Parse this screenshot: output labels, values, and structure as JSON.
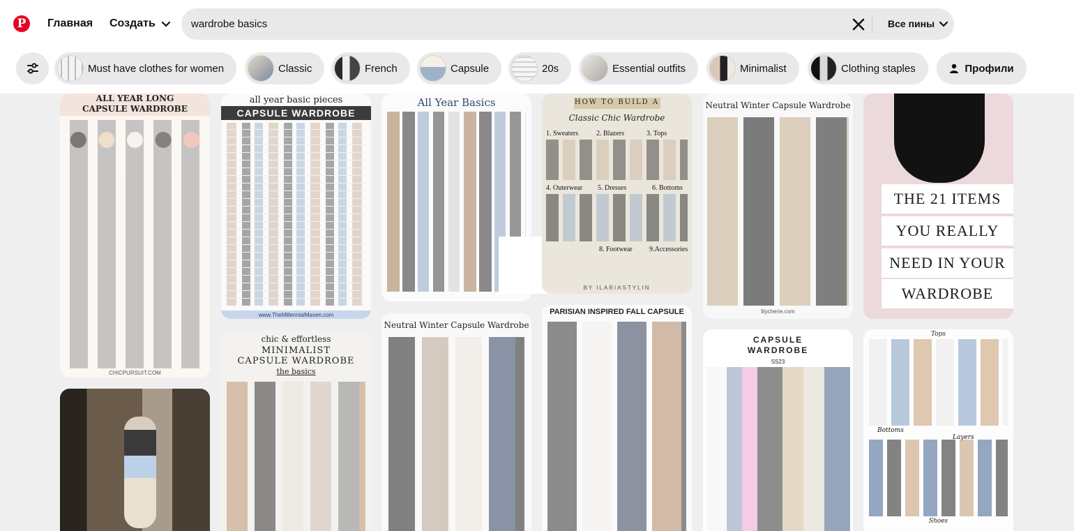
{
  "header": {
    "logo": "P",
    "home_label": "Главная",
    "create_label": "Создать",
    "search_value": "wardrobe basics",
    "search_scope": "Все пины"
  },
  "chips": [
    {
      "label": "Must have clothes for women"
    },
    {
      "label": "Classic"
    },
    {
      "label": "French"
    },
    {
      "label": "Capsule"
    },
    {
      "label": "20s"
    },
    {
      "label": "Essential outfits"
    },
    {
      "label": "Minimalist"
    },
    {
      "label": "Clothing staples"
    }
  ],
  "profiles_label": "Профили",
  "pins": {
    "p1": {
      "title": "ALL YEAR LONG\nCAPSULE WARDROBE",
      "url": "CHICPURSUIT.COM"
    },
    "p2": {
      "subtitle": "all year basic pieces",
      "title": "CAPSULE WARDROBE",
      "url": "www.TheMillennialMaven.com"
    },
    "p3": {
      "title": "All Year Basics"
    },
    "p4": {
      "band": "HOW TO BUILD A",
      "title": "Classic Chic Wardrobe",
      "credit": "BY ILARIASTYLIN",
      "sections": [
        "1. Sweaters",
        "2. Blazers",
        "3. Tops",
        "4. Outerwear",
        "5. Dresses",
        "6. Bottoms",
        "8. Footwear",
        "9.Accessories"
      ]
    },
    "p5": {
      "title": "Neutral Winter Capsule Wardrobe",
      "url": "lilycherie.com"
    },
    "p6": {
      "lines": [
        "THE 21 ITEMS",
        "YOU REALLY",
        "NEED IN YOUR",
        "WARDROBE"
      ]
    },
    "p8": {
      "subtitle": "chic & effortless",
      "title": "MINIMALIST\nCAPSULE WARDROBE",
      "tag": "the basics"
    },
    "p9": {
      "title": "Neutral Winter Capsule Wardrobe"
    },
    "p10": {
      "title": "PARISIAN INSPIRED FALL CAPSULE"
    },
    "p11": {
      "title": "CAPSULE\nWARDROBE",
      "season": "SS23"
    },
    "p12": {
      "section_tops": "Tops",
      "section_bottoms": "Bottoms",
      "section_layers": "Layers",
      "section_shoes": "Shoes"
    }
  },
  "colors": {
    "brand": "#e60023",
    "chip_bg": "#e9e9e9",
    "feed_bg": "#efefef"
  }
}
